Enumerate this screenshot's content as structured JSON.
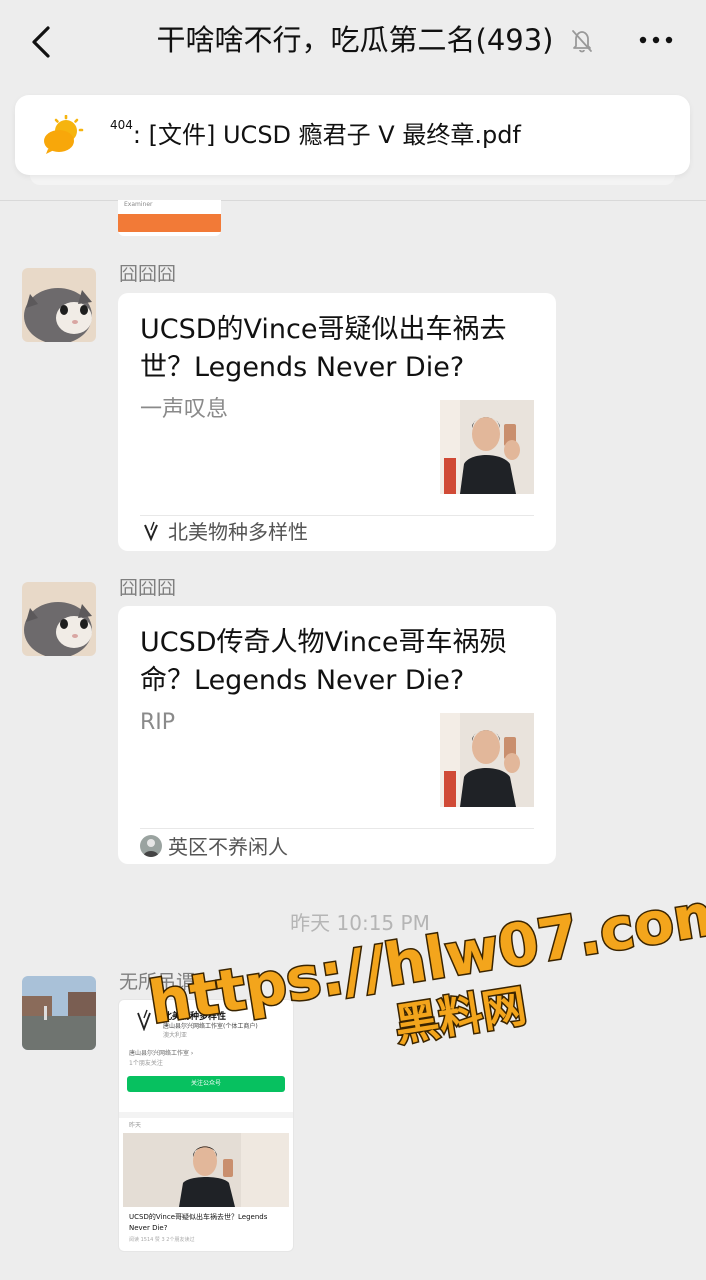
{
  "header": {
    "title": "干啥啥不行，吃瓜第二名(493)",
    "back_icon": "chevron-left-icon",
    "mute_icon": "bell-muted-icon",
    "more_icon": "more-dots-icon"
  },
  "pinned": {
    "icon": "sun-cloud-icon",
    "sender_prefix": "404",
    "sender_suffix": ":",
    "text": "[文件] UCSD 瘾君子 V 最终章.pdf"
  },
  "partial_file": {
    "label": "Examiner"
  },
  "messages": [
    {
      "sender": "囧囧囧",
      "card": {
        "title": "UCSD的Vince哥疑似出车祸去世？Legends Never Die?",
        "desc": "一声叹息",
        "source": "北美物种多样性",
        "source_icon": "v-logo-icon"
      }
    },
    {
      "sender": "囧囧囧",
      "card": {
        "title": "UCSD传奇人物Vince哥车祸殒命？Legends Never Die?",
        "desc": "RIP",
        "source": "英区不养闲人",
        "source_icon": "avatar-small-icon"
      }
    }
  ],
  "time_divider": "昨天 10:15 PM",
  "image_message": {
    "sender": "无所吊谓",
    "shot": {
      "account_name": "北美物种多样性",
      "account_owner": "唐山县尔兴网络工作室(个体工商户)",
      "account_loc": "澳大利亚",
      "follower_line": "唐山县尔兴网络工作室 ›",
      "friends_line": "1个朋友关注",
      "follow_button": "关注公众号",
      "date": "昨天",
      "caption": "UCSD的Vince哥疑似出车祸去世？Legends Never Die?",
      "stats": "阅读 1514  赞 3  2个朋友读过"
    }
  },
  "watermark": {
    "url": "https://hlw07.com",
    "name": "黑料网"
  }
}
